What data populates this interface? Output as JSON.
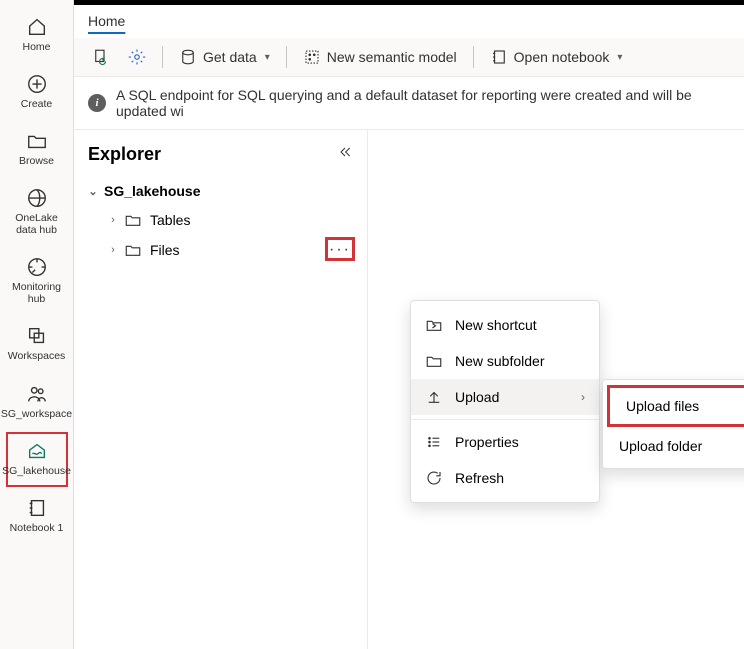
{
  "nav": {
    "home": "Home",
    "create": "Create",
    "browse": "Browse",
    "onelake": "OneLake data hub",
    "monitoring": "Monitoring hub",
    "workspaces": "Workspaces",
    "sgws": "SG_workspace",
    "sglh": "SG_lakehouse",
    "notebook": "Notebook 1"
  },
  "breadcrumb": {
    "home": "Home"
  },
  "toolbar": {
    "getdata": "Get data",
    "semantic": "New semantic model",
    "opennb": "Open notebook"
  },
  "info": {
    "msg": "A SQL endpoint for SQL querying and a default dataset for reporting were created and will be updated wi"
  },
  "explorer": {
    "title": "Explorer",
    "root": "SG_lakehouse",
    "tables": "Tables",
    "files": "Files"
  },
  "ctx": {
    "newshortcut": "New shortcut",
    "newsubfolder": "New subfolder",
    "upload": "Upload",
    "properties": "Properties",
    "refresh": "Refresh"
  },
  "sub": {
    "uploadfiles": "Upload files",
    "uploadfolder": "Upload folder"
  }
}
